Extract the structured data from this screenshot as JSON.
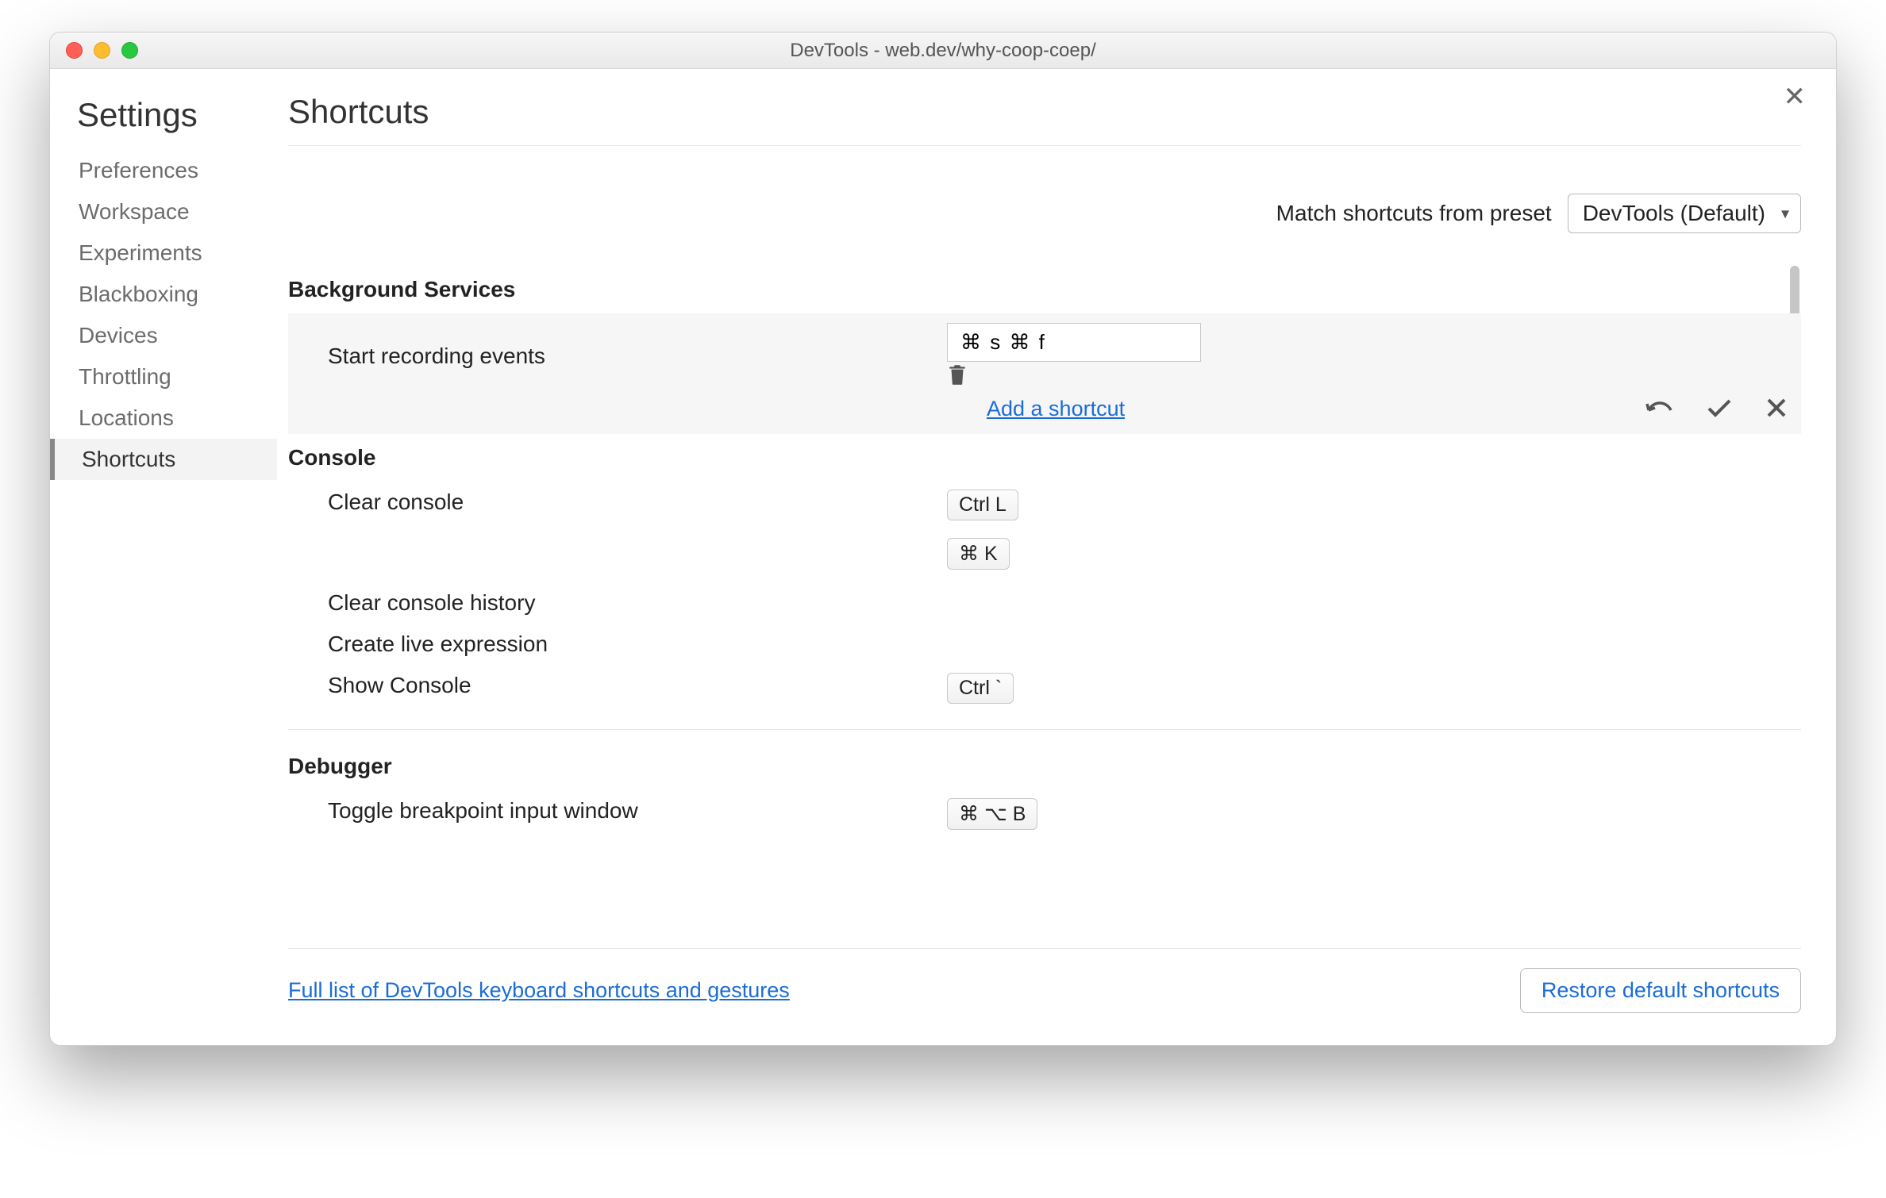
{
  "window": {
    "title": "DevTools - web.dev/why-coop-coep/"
  },
  "sidebar": {
    "heading": "Settings",
    "items": [
      {
        "label": "Preferences"
      },
      {
        "label": "Workspace"
      },
      {
        "label": "Experiments"
      },
      {
        "label": "Blackboxing"
      },
      {
        "label": "Devices"
      },
      {
        "label": "Throttling"
      },
      {
        "label": "Locations"
      },
      {
        "label": "Shortcuts",
        "active": true
      }
    ]
  },
  "panel": {
    "title": "Shortcuts",
    "preset_label": "Match shortcuts from preset",
    "preset_value": "DevTools (Default)",
    "add_shortcut_link": "Add a shortcut",
    "full_list_link": "Full list of DevTools keyboard shortcuts and gestures",
    "restore_button": "Restore default shortcuts"
  },
  "sections": {
    "bg": {
      "title": "Background Services",
      "start_recording": {
        "label": "Start recording events",
        "input_value": "⌘ s ⌘ f"
      }
    },
    "console": {
      "title": "Console",
      "clear_console": {
        "label": "Clear console",
        "chip1": "Ctrl L",
        "chip2": "⌘ K"
      },
      "clear_history": {
        "label": "Clear console history"
      },
      "create_live": {
        "label": "Create live expression"
      },
      "show_console": {
        "label": "Show Console",
        "chip": "Ctrl `"
      }
    },
    "debugger": {
      "title": "Debugger",
      "toggle_bp": {
        "label": "Toggle breakpoint input window",
        "chip": "⌘ ⌥ B"
      }
    }
  }
}
